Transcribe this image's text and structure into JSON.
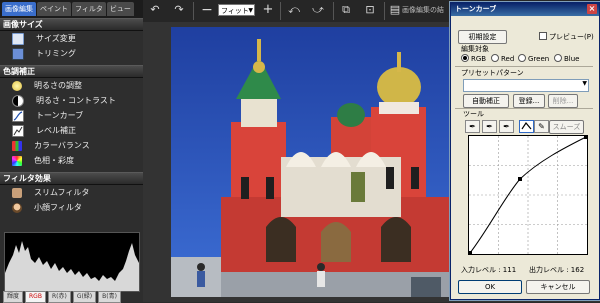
{
  "left_panel": {
    "tabs": [
      "画像編集",
      "ペイント",
      "フィルタ",
      "ビュー"
    ],
    "sections": [
      {
        "title": "画像サイズ",
        "items": [
          "サイズ変更",
          "トリミング"
        ]
      },
      {
        "title": "色調補正",
        "items": [
          "明るさの調整",
          "明るさ・コントラスト",
          "トーンカーブ",
          "レベル補正",
          "カラーバランス",
          "色相・彩度"
        ]
      },
      {
        "title": "フィルタ効果",
        "items": [
          "スリムフィルタ",
          "小顔フィルタ"
        ]
      }
    ],
    "histogram_buttons": [
      "輝度",
      "RGB",
      "R(赤)",
      "G(緑)",
      "B(青)"
    ]
  },
  "toolbar": {
    "zoom": "フィット",
    "title_text": "画像編集の結"
  },
  "dialog": {
    "title": "トーンカーブ",
    "reset_label": "初期設定",
    "preview_label": "プレビュー(P)",
    "edit_target_label": "編集対象",
    "channels": [
      "RGB",
      "Red",
      "Green",
      "Blue"
    ],
    "selected_channel": "RGB",
    "preset_label": "プリセットパターン",
    "auto_label": "自動補正",
    "register_label": "登録...",
    "delete_label": "削除...",
    "tools_label": "ツール",
    "smooth_label": "スムーズ",
    "input_level_label": "入力レベル : 111",
    "output_level_label": "出力レベル : 162",
    "ok_label": "OK",
    "cancel_label": "キャンセル"
  }
}
